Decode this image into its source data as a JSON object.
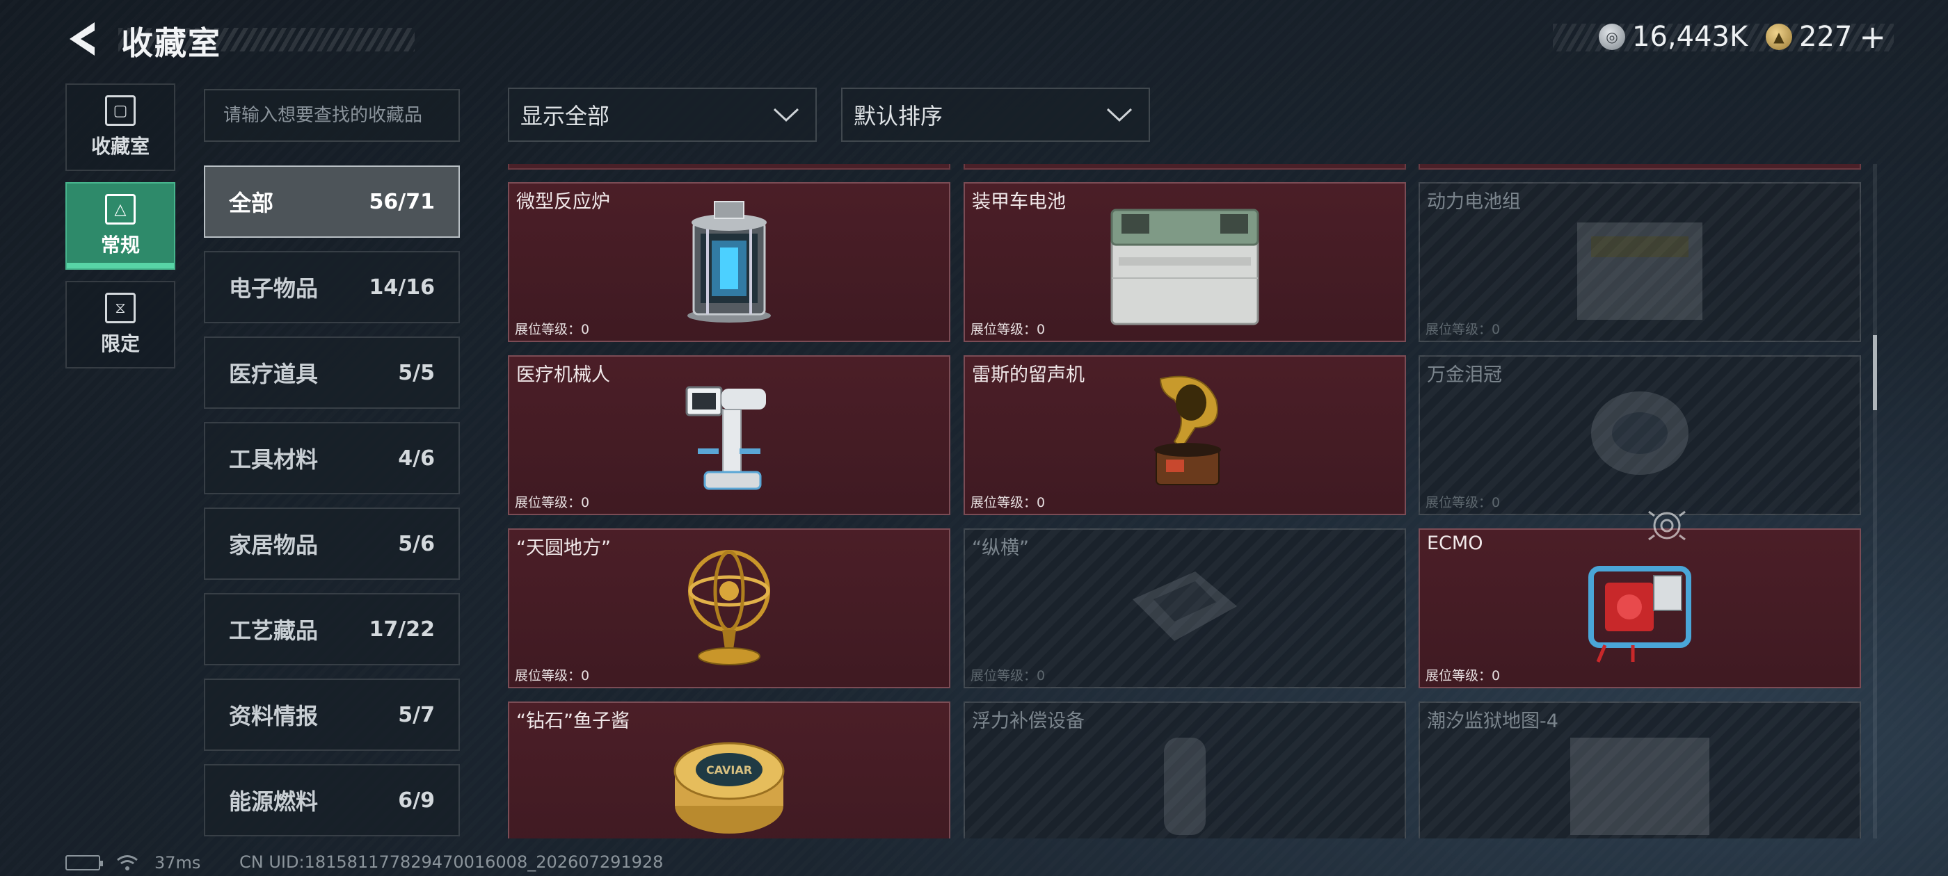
{
  "header": {
    "title": "收藏室",
    "currency": [
      {
        "icon": "silver-coin-icon",
        "value": "16,443K"
      },
      {
        "icon": "gold-coin-icon",
        "value": "227"
      }
    ],
    "add_label": "+"
  },
  "rail": [
    {
      "label": "收藏室",
      "icon": "collection-room-icon",
      "active": false
    },
    {
      "label": "常规",
      "icon": "regular-icon",
      "active": true
    },
    {
      "label": "限定",
      "icon": "limited-icon",
      "active": false
    }
  ],
  "search": {
    "placeholder": "请输入想要查找的收藏品",
    "value": ""
  },
  "categories": [
    {
      "label": "全部",
      "count": "56/71",
      "active": true
    },
    {
      "label": "电子物品",
      "count": "14/16"
    },
    {
      "label": "医疗道具",
      "count": "5/5"
    },
    {
      "label": "工具材料",
      "count": "4/6"
    },
    {
      "label": "家居物品",
      "count": "5/6"
    },
    {
      "label": "工艺藏品",
      "count": "17/22"
    },
    {
      "label": "资料情报",
      "count": "5/7"
    },
    {
      "label": "能源燃料",
      "count": "6/9"
    }
  ],
  "filters": {
    "show": "显示全部",
    "sort": "默认排序"
  },
  "items": [
    {
      "name": "微型反应炉",
      "level": "展位等级：0",
      "owned": true,
      "icon": "reactor-icon"
    },
    {
      "name": "装甲车电池",
      "level": "展位等级：0",
      "owned": true,
      "icon": "battery-icon"
    },
    {
      "name": "动力电池组",
      "level": "展位等级：0",
      "owned": false,
      "icon": "power-battery-icon"
    },
    {
      "name": "医疗机械人",
      "level": "展位等级：0",
      "owned": true,
      "icon": "medical-robot-icon"
    },
    {
      "name": "雷斯的留声机",
      "level": "展位等级：0",
      "owned": true,
      "icon": "gramophone-icon"
    },
    {
      "name": "万金泪冠",
      "level": "展位等级：0",
      "owned": false,
      "icon": "crown-icon"
    },
    {
      "name": "“天圆地方”",
      "level": "展位等级：0",
      "owned": true,
      "icon": "armillary-icon"
    },
    {
      "name": "“纵横”",
      "level": "展位等级：0",
      "owned": false,
      "icon": "chessboard-icon"
    },
    {
      "name": "ECMO",
      "level": "展位等级：0",
      "owned": true,
      "icon": "ecmo-icon"
    },
    {
      "name": "“钻石”鱼子酱",
      "level": "",
      "owned": true,
      "icon": "caviar-icon"
    },
    {
      "name": "浮力补偿设备",
      "level": "",
      "owned": false,
      "icon": "buoyancy-icon"
    },
    {
      "name": "潮汐监狱地图-4",
      "level": "",
      "owned": false,
      "icon": "map-icon"
    }
  ],
  "caviar_label": "CAVIAR",
  "footer": {
    "latency": "37ms",
    "uid": "CN UID:181581177829470016008_202607291928"
  }
}
